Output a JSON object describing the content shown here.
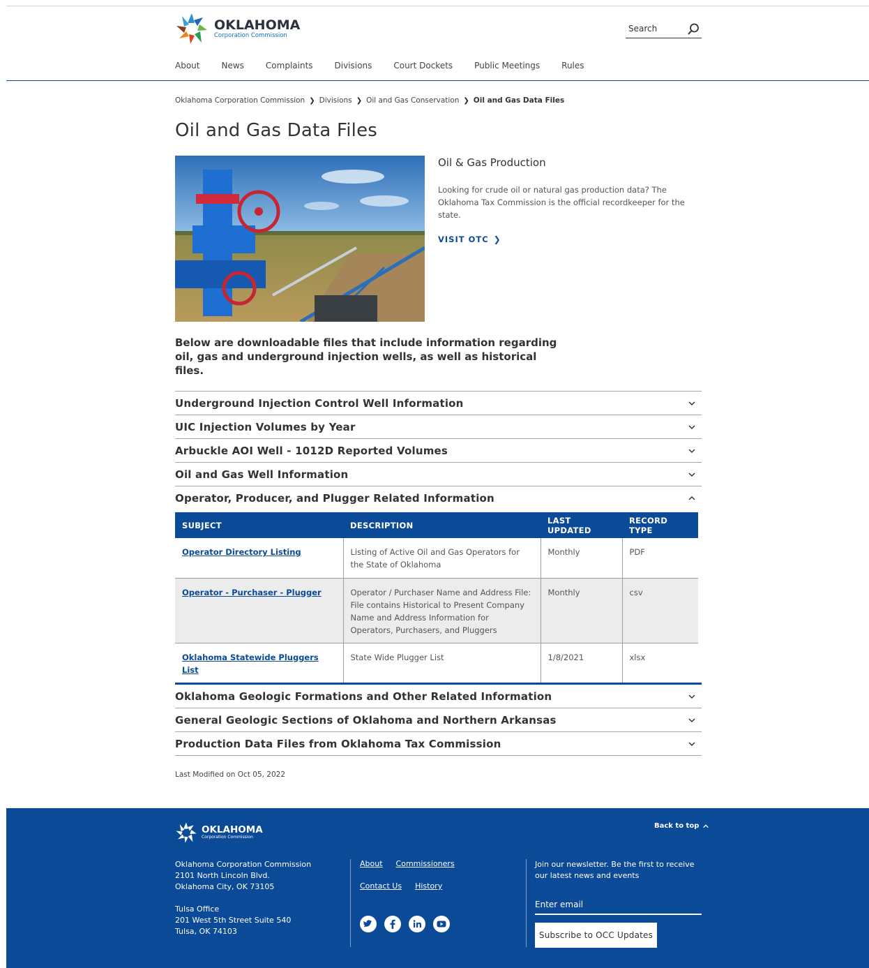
{
  "header": {
    "logo_name": "OKLAHOMA",
    "logo_sub": "Corporation Commission",
    "search_label": "Search",
    "nav": [
      "About",
      "News",
      "Complaints",
      "Divisions",
      "Court Dockets",
      "Public Meetings",
      "Rules"
    ]
  },
  "breadcrumb": [
    "Oklahoma Corporation Commission",
    "Divisions",
    "Oil and Gas Conservation",
    "Oil and Gas Data Files"
  ],
  "page_title": "Oil and Gas Data Files",
  "feature": {
    "heading": "Oil & Gas Production",
    "body": "Looking for crude oil or natural gas production data? The Oklahoma Tax Commission is the official recordkeeper for the state.",
    "link": "VISIT OTC"
  },
  "intro": "Below are downloadable files that include information regarding oil, gas and underground injection wells, as well as historical files.",
  "accordion_top": [
    "Underground Injection Control Well Information",
    "UIC Injection Volumes by Year",
    "Arbuckle AOI Well - 1012D Reported Volumes",
    "Oil and Gas Well Information",
    "Operator, Producer, and Plugger Related Information"
  ],
  "table": {
    "headers": [
      "SUBJECT",
      "DESCRIPTION",
      "LAST UPDATED",
      "RECORD TYPE"
    ],
    "rows": [
      {
        "subject": "Operator Directory Listing",
        "description": "Listing of Active Oil and Gas Operators for the State of Oklahoma",
        "updated": "Monthly",
        "type": "PDF"
      },
      {
        "subject": "Operator - Purchaser - Plugger",
        "description": "Operator / Purchaser Name and Address File: File contains Historical to Present Company Name and Address Information for Operators, Purchasers, and Pluggers",
        "updated": "Monthly",
        "type": "csv"
      },
      {
        "subject": "Oklahoma Statewide Pluggers List",
        "description": "State Wide Plugger List",
        "updated": "1/8/2021",
        "type": "xlsx"
      }
    ]
  },
  "accordion_bottom": [
    "Oklahoma Geologic Formations and Other Related Information",
    "General Geologic Sections of Oklahoma and Northern Arkansas",
    "Production Data Files from Oklahoma Tax Commission"
  ],
  "last_modified": "Last Modified on Oct 05, 2022",
  "footer": {
    "logo_name": "OKLAHOMA",
    "logo_sub": "Corporation Commission",
    "back_to_top": "Back to top",
    "address": {
      "org": "Oklahoma Corporation Commission",
      "street": "2101 North Lincoln Blvd.",
      "city": "Oklahoma City, OK 73105",
      "office": "Tulsa Office",
      "office_street": "201 West 5th Street Suite 540",
      "office_city": "Tulsa, OK 74103"
    },
    "links": [
      "About",
      "Commissioners",
      "Contact Us",
      "History"
    ],
    "social": [
      "twitter-icon",
      "facebook-icon",
      "linkedin-icon",
      "youtube-icon"
    ],
    "newsletter": "Join our newsletter. Be the first to receive our latest news and events",
    "email_placeholder": "Enter email",
    "subscribe": "Subscribe to OCC Updates"
  },
  "colors": {
    "brand_blue": "#0b4a97",
    "alt_row": "#ececec"
  }
}
